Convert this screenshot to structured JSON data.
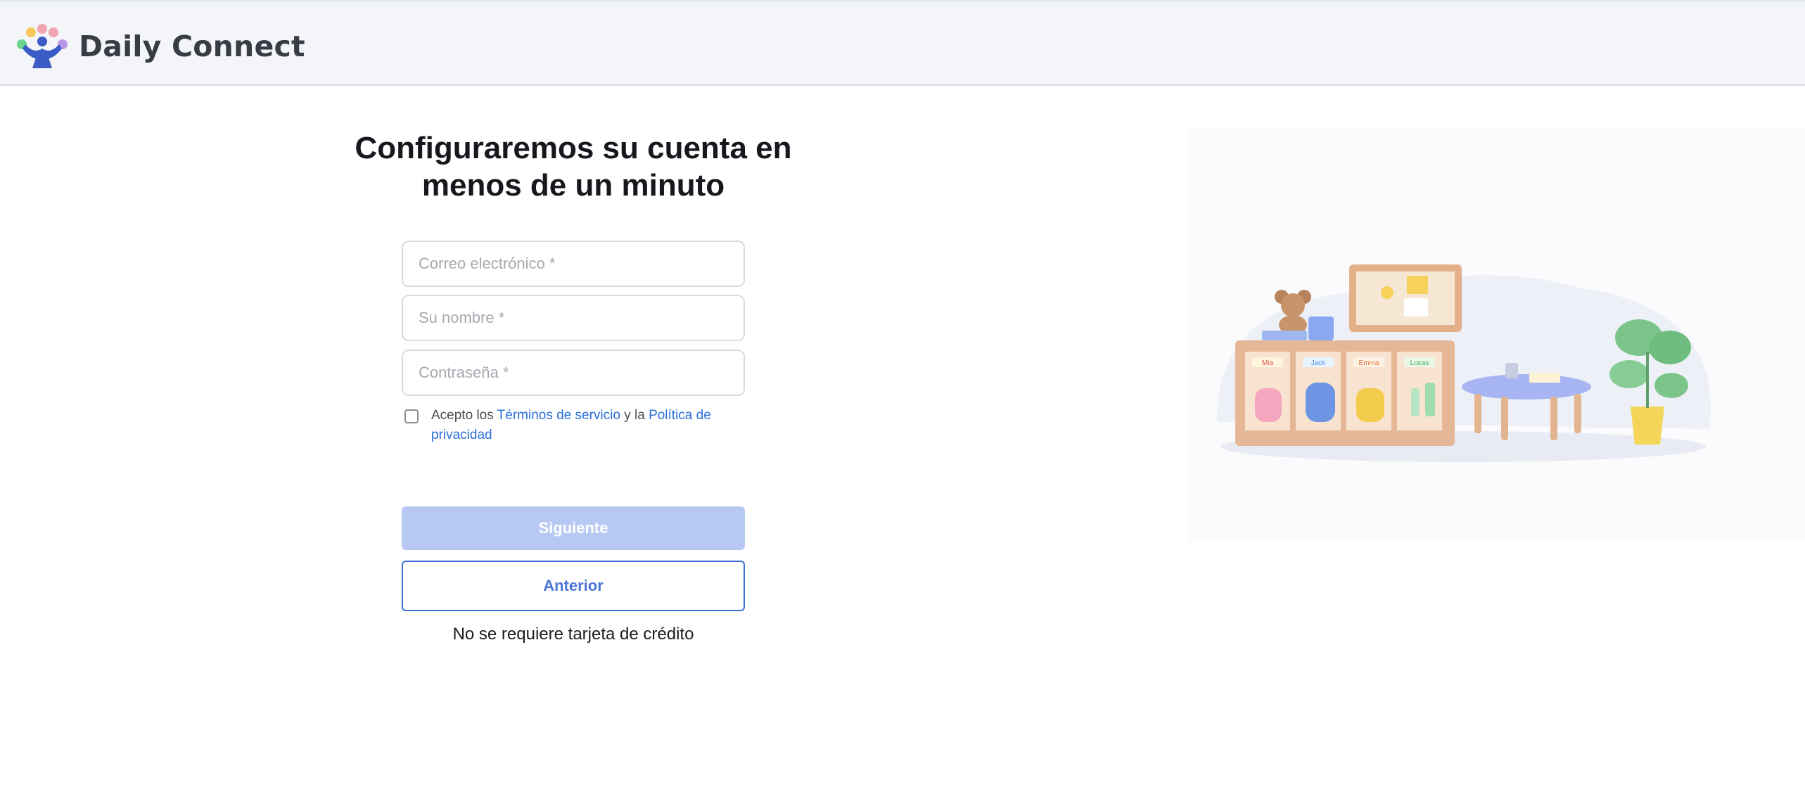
{
  "header": {
    "brand_name": "Daily Connect",
    "logo_icon": "daily-connect-people-logo"
  },
  "signup": {
    "heading_line1": "Configuraremos su cuenta en",
    "heading_line2": "menos de un minuto",
    "email_placeholder": "Correo electrónico *",
    "email_value": "",
    "name_placeholder": "Su nombre *",
    "name_value": "",
    "password_placeholder": "Contraseña *",
    "password_value": "",
    "terms_prefix": "Acepto los ",
    "terms_link": "Términos de servicio",
    "terms_middle": " y la ",
    "privacy_link": "Política de privacidad",
    "terms_checked": false,
    "next_label": "Siguiente",
    "prev_label": "Anterior",
    "no_card_note": "No se requiere tarjeta de crédito"
  },
  "illustration": {
    "cubby_names": [
      "Mia",
      "Jack",
      "Emma",
      "Lucas"
    ]
  },
  "colors": {
    "primary_disabled": "#b7c9f3",
    "primary": "#3f6fd9",
    "link": "#2a6fd8",
    "header_bg": "#f3f5f9"
  }
}
